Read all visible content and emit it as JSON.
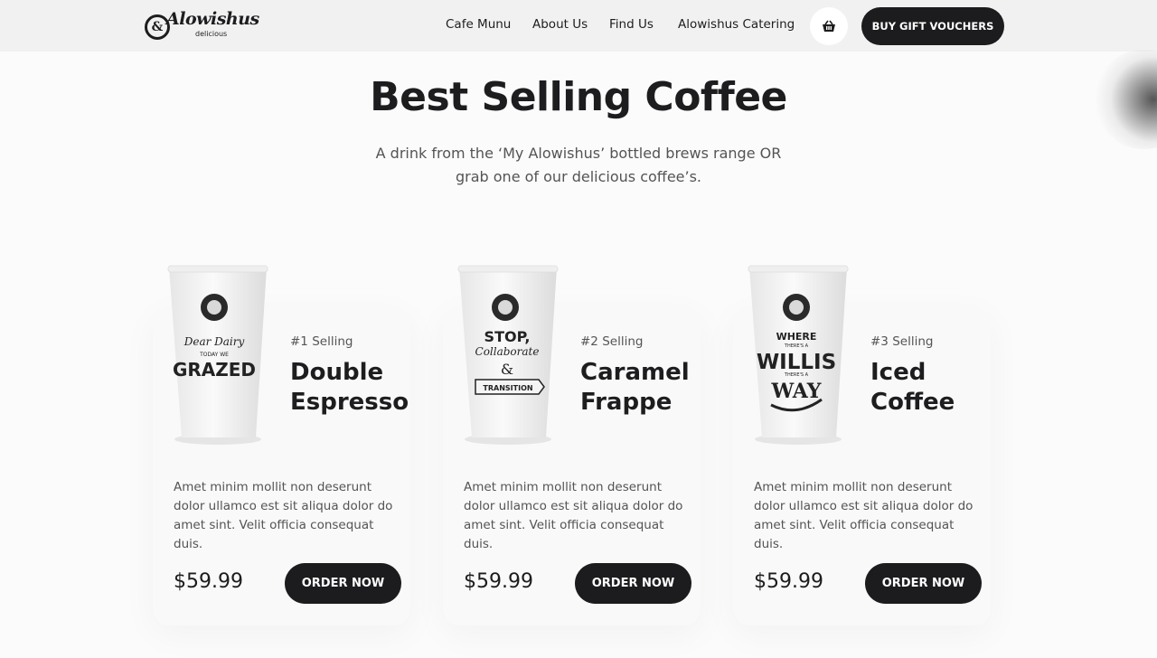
{
  "brand": {
    "logo_mark": "&",
    "logo_script": "Alowishus",
    "logo_sub": "delicious"
  },
  "nav": {
    "items": [
      {
        "label": "Cafe Munu"
      },
      {
        "label": "About Us"
      },
      {
        "label": "Find Us"
      },
      {
        "label": "Alowishus Catering"
      }
    ],
    "cart_icon": "basket-icon",
    "gift_button": "BUY GIFT VOUCHERS"
  },
  "hero": {
    "title": "Best Selling Coffee",
    "subtitle": "A drink from the ‘My Alowishus’ bottled brews range OR grab one of our delicious coffee’s."
  },
  "products": [
    {
      "rank": "#1 Selling",
      "name": "Double Espresso",
      "description": "Amet minim mollit non deserunt dolor ullamco est sit aliqua dolor do amet sint. Velit officia consequat duis.",
      "price": "$59.99",
      "button": "ORDER NOW",
      "cup_lines": [
        "Dear Dairy",
        "TODAY WE",
        "GRAZED"
      ]
    },
    {
      "rank": "#2 Selling",
      "name": "Caramel Frappe",
      "description": "Amet minim mollit non deserunt dolor ullamco est sit aliqua dolor do amet sint. Velit officia consequat duis.",
      "price": "$59.99",
      "button": "ORDER NOW",
      "cup_lines": [
        "STOP,",
        "Collaborate",
        "&",
        "TRANSITION"
      ]
    },
    {
      "rank": "#3 Selling",
      "name": "Iced Coffee",
      "description": "Amet minim mollit non deserunt dolor ullamco est sit aliqua dolor do amet sint. Velit officia consequat duis.",
      "price": "$59.99",
      "button": "ORDER NOW",
      "cup_lines": [
        "WHERE",
        "THERE'S A",
        "WILLIS",
        "THERE'S A",
        "WAY"
      ]
    }
  ],
  "colors": {
    "accent": "#1c1c1e",
    "background": "#fbfbfb",
    "header": "#f1f1f2",
    "muted_text": "#545454"
  }
}
